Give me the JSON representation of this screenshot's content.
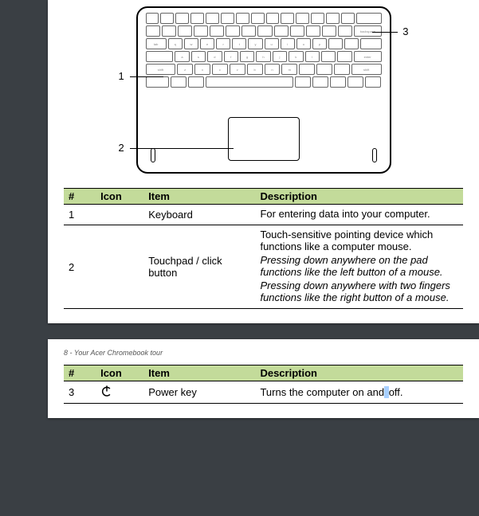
{
  "page1": {
    "callouts": {
      "c1": "1",
      "c2": "2",
      "c3": "3"
    },
    "table": {
      "headers": {
        "num": "#",
        "icon": "Icon",
        "item": "Item",
        "desc": "Description"
      },
      "rows": [
        {
          "num": "1",
          "icon": "",
          "item": "Keyboard",
          "desc_plain": "For entering data into your computer."
        },
        {
          "num": "2",
          "icon": "",
          "item": "Touchpad / click button",
          "desc_plain": "Touch-sensitive pointing device which functions like a computer mouse.",
          "desc_ital1": "Pressing down anywhere on the pad functions like the left button of a mouse.",
          "desc_ital2": "Pressing down anywhere with two fingers functions like the right button of a mouse."
        }
      ]
    }
  },
  "page2": {
    "header": "8 - Your Acer Chromebook tour",
    "table": {
      "headers": {
        "num": "#",
        "icon": "Icon",
        "item": "Item",
        "desc": "Description"
      },
      "rows": [
        {
          "num": "3",
          "icon": "power-icon",
          "item": "Power key",
          "desc_pre": "Turns the computer on and",
          "desc_hl": " ",
          "desc_post": "off."
        }
      ]
    }
  }
}
